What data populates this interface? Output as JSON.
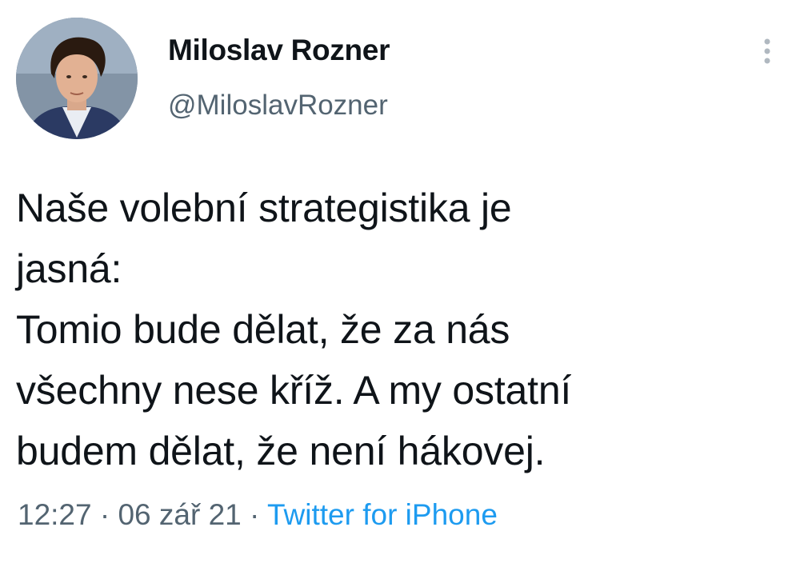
{
  "author": {
    "name": "Miloslav Rozner",
    "handle": "@MiloslavRozner",
    "avatar_icon": "profile-photo"
  },
  "menu_icon": "more-vertical-icon",
  "tweet": {
    "lines": [
      "Naše volební strategistika je",
      "jasná:",
      "Tomio bude dělat, že za nás",
      "všechny nese kříž. A my ostatní",
      "budem dělat, že není hákovej."
    ]
  },
  "meta": {
    "time": "12:27",
    "separator1": " · ",
    "date": "06 zář 21",
    "separator2": " · ",
    "source": "Twitter for iPhone"
  },
  "colors": {
    "text": "#0f1419",
    "secondary": "#536471",
    "link": "#1d9bf0"
  }
}
